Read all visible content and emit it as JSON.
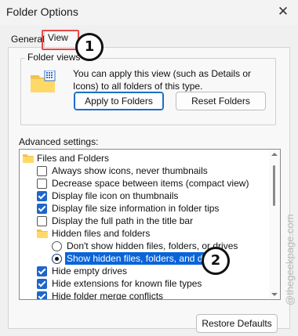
{
  "window": {
    "title": "Folder Options",
    "close_glyph": "✕"
  },
  "tabs": [
    {
      "label": "General"
    },
    {
      "label": "View",
      "selected": true
    },
    {
      "label": "Search",
      "visible_label": "ch"
    }
  ],
  "folder_views": {
    "label": "Folder views",
    "description": "You can apply this view (such as Details or Icons) to all folders of this type.",
    "apply_button": "Apply to Folders",
    "reset_button": "Reset Folders",
    "icon": "folder-grid-icon"
  },
  "advanced": {
    "label": "Advanced settings:",
    "rows": [
      {
        "type": "folder",
        "label": "Files and Folders"
      },
      {
        "type": "checkbox",
        "label": "Always show icons, never thumbnails",
        "checked": false
      },
      {
        "type": "checkbox",
        "label": "Decrease space between items (compact view)",
        "checked": false
      },
      {
        "type": "checkbox",
        "label": "Display file icon on thumbnails",
        "checked": true
      },
      {
        "type": "checkbox",
        "label": "Display file size information in folder tips",
        "checked": true
      },
      {
        "type": "checkbox",
        "label": "Display the full path in the title bar",
        "checked": false
      },
      {
        "type": "folder",
        "label": "Hidden files and folders"
      },
      {
        "type": "radio",
        "label": "Don't show hidden files, folders, or drives",
        "checked": false
      },
      {
        "type": "radio",
        "label": "Show hidden files, folders, and drives",
        "checked": true,
        "selected": true
      },
      {
        "type": "checkbox",
        "label": "Hide empty drives",
        "checked": true
      },
      {
        "type": "checkbox",
        "label": "Hide extensions for known file types",
        "checked": true
      },
      {
        "type": "checkbox",
        "label": "Hide folder merge conflicts",
        "checked": true
      }
    ]
  },
  "restore_button": "Restore Defaults",
  "annotations": [
    {
      "label": "1"
    },
    {
      "label": "2"
    }
  ],
  "watermark": "@thegeekpage.com",
  "colors": {
    "accent": "#0a64d8",
    "annotation": "#e8484a"
  }
}
